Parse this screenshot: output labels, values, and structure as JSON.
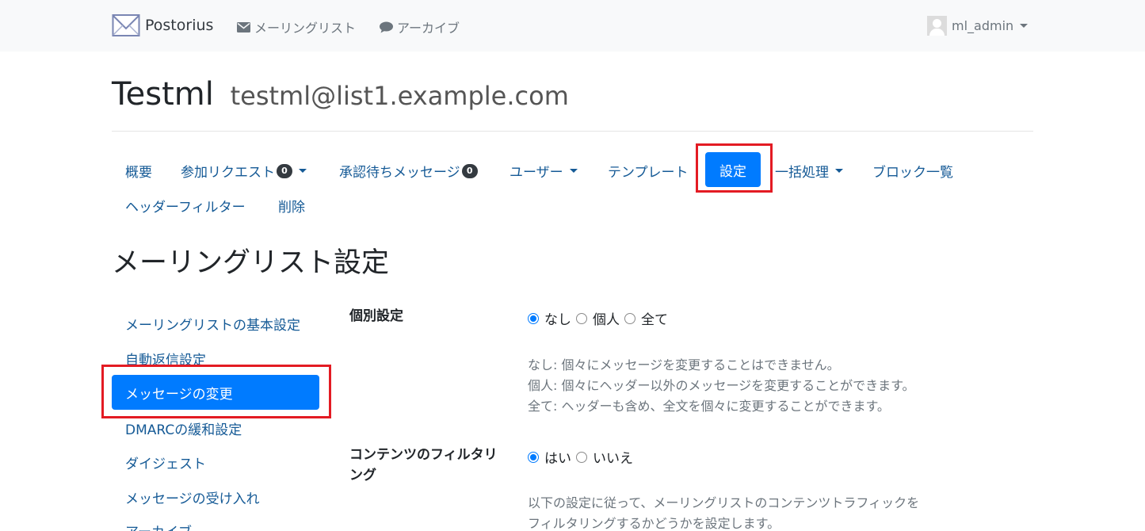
{
  "navbar": {
    "brand": "Postorius",
    "mailing_lists": "メーリングリスト",
    "archives": "アーカイブ",
    "user": "ml_admin"
  },
  "list": {
    "name": "Testml",
    "address": "testml@list1.example.com"
  },
  "tabs": {
    "summary": "概要",
    "subscription_requests": "参加リクエスト",
    "subscription_requests_count": "0",
    "held_messages": "承認待ちメッセージ",
    "held_messages_count": "0",
    "users": "ユーザー",
    "templates": "テンプレート",
    "settings": "設定",
    "mass_operations": "一括処理",
    "ban_list": "ブロック一覧",
    "header_filters": "ヘッダーフィルター",
    "delete": "削除"
  },
  "page_title": "メーリングリスト設定",
  "side_menu": [
    "メーリングリストの基本設定",
    "自動返信設定",
    "メッセージの変更",
    "DMARCの緩和設定",
    "ダイジェスト",
    "メッセージの受け入れ",
    "アーカイブ"
  ],
  "side_menu_active": "メッセージの変更",
  "form": {
    "personalize": {
      "label": "個別設定",
      "options": [
        "なし",
        "個人",
        "全て"
      ],
      "selected": "なし",
      "help": [
        "なし: 個々にメッセージを変更することはできません。",
        "個人: 個々にヘッダー以外のメッセージを変更することができます。",
        "全て: ヘッダーも含め、全文を個々に変更することができます。"
      ]
    },
    "filter_content": {
      "label": "コンテンツのフィルタリング",
      "options": [
        "はい",
        "いいえ"
      ],
      "selected": "はい",
      "help": [
        "以下の設定に従って、メーリングリストのコンテンツトラフィックを",
        "フィルタリングするかどうかを設定します。"
      ]
    }
  },
  "colors": {
    "link": "#155a96",
    "primary": "#007bff",
    "highlight": "#e31b23",
    "navbar_bg": "#f8f9fa"
  }
}
